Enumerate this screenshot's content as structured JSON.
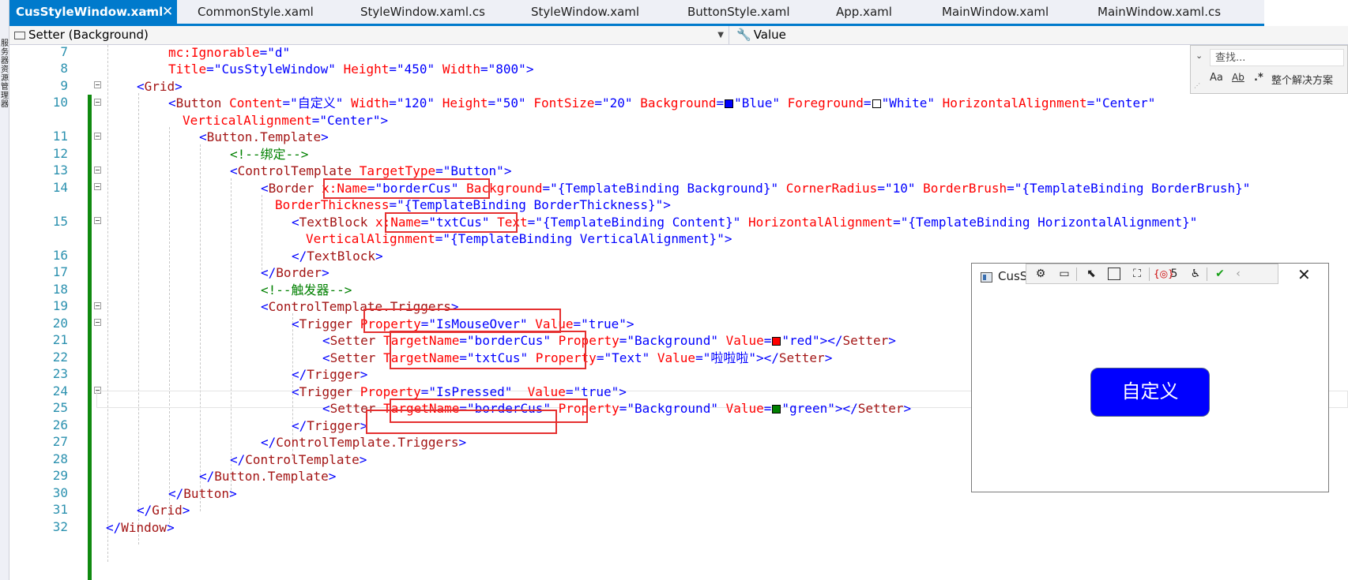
{
  "tabs": [
    {
      "label": "CusStyleWindow.xaml",
      "active": true,
      "pin": "⊸",
      "close": "✕"
    },
    {
      "label": "CommonStyle.xaml"
    },
    {
      "label": "StyleWindow.xaml.cs"
    },
    {
      "label": "StyleWindow.xaml"
    },
    {
      "label": "ButtonStyle.xaml"
    },
    {
      "label": "App.xaml"
    },
    {
      "label": "MainWindow.xaml"
    },
    {
      "label": "MainWindow.xaml.cs"
    }
  ],
  "left_strip_text": "服务器资源管理器",
  "navbar": {
    "left": "Setter (Background)",
    "right": "Value"
  },
  "find": {
    "placeholder": "查找...",
    "opt_case": "Aa",
    "opt_word": "Ab",
    "opt_regex": ".*",
    "scope": "整个解决方案"
  },
  "line_numbers": [
    "7",
    "8",
    "9",
    "10",
    "",
    "11",
    "12",
    "13",
    "14",
    "",
    "15",
    "",
    "16",
    "17",
    "18",
    "19",
    "20",
    "21",
    "22",
    "23",
    "24",
    "25",
    "26",
    "27",
    "28",
    "29",
    "30",
    "31",
    "32"
  ],
  "code": {
    "l7": {
      "attr": "mc:Ignorable",
      "val": "\"d\""
    },
    "l8": {
      "a1": "Title",
      "v1": "\"CusStyleWindow\"",
      "a2": "Height",
      "v2": "\"450\"",
      "a3": "Width",
      "v3": "\"800\"",
      "close": ">"
    },
    "l9": {
      "tag": "Grid"
    },
    "l10": {
      "tag": "Button",
      "a1": "Content",
      "v1": "\"自定义\"",
      "a2": "Width",
      "v2": "\"120\"",
      "a3": "Height",
      "v3": "\"50\"",
      "a4": "FontSize",
      "v4": "\"20\"",
      "a5": "Background",
      "v5": "\"Blue\"",
      "a6": "Foreground",
      "v6": "\"White\"",
      "a7": "HorizontalAlignment",
      "v7": "\"Center\""
    },
    "l10b": {
      "a1": "VerticalAlignment",
      "v1": "\"Center\""
    },
    "l11": {
      "tag": "Button.Template"
    },
    "l12": {
      "comment": "<!--绑定-->"
    },
    "l13": {
      "tag": "ControlTemplate",
      "a1": "TargetType",
      "v1": "\"Button\""
    },
    "l14": {
      "tag": "Border",
      "a1": "x:Name",
      "v1": "\"borderCus\"",
      "a2": "Background",
      "v2": "\"{TemplateBinding Background}\"",
      "a3": "CornerRadius",
      "v3": "\"10\"",
      "a4": "BorderBrush",
      "v4": "\"{TemplateBinding BorderBrush}\""
    },
    "l14b": {
      "a1": "BorderThickness",
      "v1": "\"{TemplateBinding BorderThickness}\""
    },
    "l15": {
      "tag": "TextBlock",
      "a1": "x:Name",
      "v1": "\"txtCus\"",
      "a2": "Text",
      "v2": "\"{TemplateBinding Content}\"",
      "a3": "HorizontalAlignment",
      "v3": "\"{TemplateBinding HorizontalAlignment}\""
    },
    "l15b": {
      "a1": "VerticalAlignment",
      "v1": "\"{TemplateBinding VerticalAlignment}\""
    },
    "l16": {
      "tag": "TextBlock"
    },
    "l17": {
      "tag": "Border"
    },
    "l18": {
      "comment": "<!--触发器-->"
    },
    "l19": {
      "tag": "ControlTemplate.Triggers"
    },
    "l20": {
      "tag": "Trigger",
      "a1": "Property",
      "v1": "\"IsMouseOver\"",
      "a2": "Value",
      "v2": "\"true\""
    },
    "l21": {
      "tag": "Setter",
      "a1": "TargetName",
      "v1": "\"borderCus\"",
      "a2": "Property",
      "v2": "\"Background\"",
      "a3": "Value",
      "v3": "\"red\""
    },
    "l22": {
      "tag": "Setter",
      "a1": "TargetName",
      "v1": "\"txtCus\"",
      "a2": "Property",
      "v2": "\"Text\"",
      "a3": "Value",
      "v3": "\"啦啦啦\""
    },
    "l23": {
      "tag": "Trigger"
    },
    "l24": {
      "tag": "Trigger",
      "a1": "Property",
      "v1": "\"IsPressed\"",
      "a2": "Value",
      "v2": "\"true\""
    },
    "l25": {
      "tag": "Setter",
      "a1": "TargetName",
      "v1": "\"borderCus\"",
      "a2": "Property",
      "v2": "\"Background\"",
      "a3": "Value",
      "v3": "\"green\""
    },
    "l26": {
      "tag": "Trigger"
    },
    "l27": {
      "tag": "ControlTemplate.Triggers"
    },
    "l28": {
      "tag": "ControlTemplate"
    },
    "l29": {
      "tag": "Button.Template"
    },
    "l30": {
      "tag": "Button"
    },
    "l31": {
      "tag": "Grid"
    },
    "l32": {
      "tag": "Window"
    }
  },
  "swatches": {
    "blue": "#0000ff",
    "white": "#ffffff",
    "red": "#ff0000",
    "green": "#008000"
  },
  "preview": {
    "title": "CusS",
    "button_label": "自定义",
    "button_color": "#0000ff",
    "badge_count": "5",
    "close": "✕"
  },
  "colors": {
    "accent": "#007acc",
    "highlight_box": "#e53030",
    "change_bar": "#108a10"
  }
}
